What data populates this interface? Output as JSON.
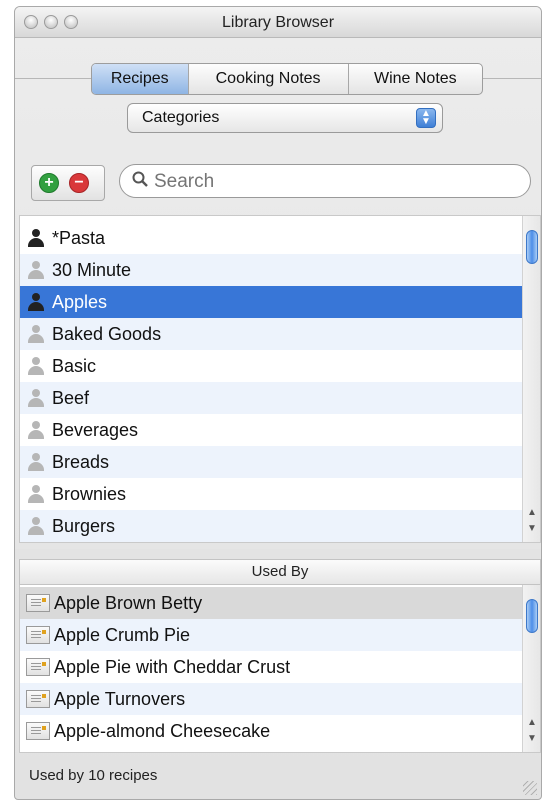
{
  "window": {
    "title": "Library Browser"
  },
  "tabs": [
    {
      "label": "Recipes",
      "active": true
    },
    {
      "label": "Cooking Notes",
      "active": false
    },
    {
      "label": "Wine Notes",
      "active": false
    }
  ],
  "popup": {
    "selected": "Categories",
    "arrows": "▲▼"
  },
  "toolbar": {
    "add_symbol": "+",
    "remove_symbol": "−",
    "search_placeholder": "Search",
    "search_glyph": "⌕"
  },
  "categories": {
    "items": [
      {
        "label": "*Pasta",
        "icon": "person-dark-icon"
      },
      {
        "label": "30 Minute",
        "icon": "person-gray-icon"
      },
      {
        "label": "Apples",
        "icon": "person-dark-icon",
        "selected": true
      },
      {
        "label": "Baked Goods",
        "icon": "person-gray-icon"
      },
      {
        "label": "Basic",
        "icon": "person-gray-icon"
      },
      {
        "label": "Beef",
        "icon": "person-gray-icon"
      },
      {
        "label": "Beverages",
        "icon": "person-gray-icon"
      },
      {
        "label": "Breads",
        "icon": "person-gray-icon"
      },
      {
        "label": "Brownies",
        "icon": "person-gray-icon"
      },
      {
        "label": "Burgers",
        "icon": "person-gray-icon"
      }
    ]
  },
  "used_by": {
    "header": "Used By",
    "items": [
      {
        "label": "Apple Brown Betty",
        "highlighted": true
      },
      {
        "label": "Apple Crumb Pie"
      },
      {
        "label": "Apple Pie with Cheddar Crust"
      },
      {
        "label": "Apple Turnovers"
      },
      {
        "label": "Apple-almond Cheesecake"
      }
    ]
  },
  "status": {
    "text": "Used by 10 recipes"
  },
  "colors": {
    "selection": "#3876d7",
    "alt_row": "#edf3fc",
    "accent": "#4d8ee8"
  }
}
